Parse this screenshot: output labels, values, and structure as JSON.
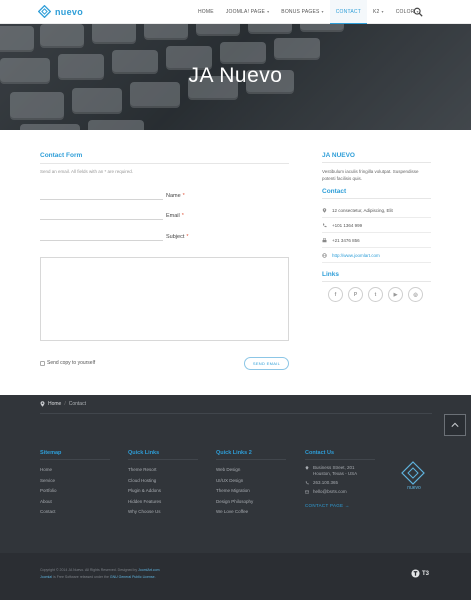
{
  "header": {
    "logo_text": "nuevo",
    "nav": [
      {
        "label": "HOME",
        "dropdown": false,
        "active": false
      },
      {
        "label": "JOOMLA! PAGE",
        "dropdown": true,
        "active": false
      },
      {
        "label": "BONUS PAGES",
        "dropdown": true,
        "active": false
      },
      {
        "label": "CONTACT",
        "dropdown": false,
        "active": true
      },
      {
        "label": "K2",
        "dropdown": true,
        "active": false
      },
      {
        "label": "COLOR",
        "dropdown": true,
        "active": false
      }
    ],
    "caret": "▾",
    "search_icon": "search-icon"
  },
  "hero": {
    "title": "JA Nuevo"
  },
  "form": {
    "title": "Contact Form",
    "note": "Send an email. All fields with an * are required.",
    "name_label": "Name",
    "email_label": "Email",
    "subject_label": "Subject",
    "required_mark": "*",
    "copy_label": "Send copy to yourself",
    "send_button": "SEND EMAIL"
  },
  "sidebar": {
    "title": "JA NUEVO",
    "description": "Vestibulum iaculis fringilla volutpat. Suspendisse potenti facilisis quis.",
    "contact_title": "Contact",
    "address": "12 consectetur, Adipiscing, Elit",
    "phone": "+101 1364 999",
    "fax": "+21 3476 856",
    "website": "http://www.joomlart.com",
    "links_title": "Links",
    "social": [
      {
        "icon": "facebook-icon",
        "glyph": "f"
      },
      {
        "icon": "pinterest-icon",
        "glyph": "P"
      },
      {
        "icon": "twitter-icon",
        "glyph": "t"
      },
      {
        "icon": "youtube-icon",
        "glyph": "▶"
      },
      {
        "icon": "instagram-icon",
        "glyph": "◎"
      }
    ]
  },
  "footer": {
    "breadcrumb": {
      "home": "Home",
      "separator": "/",
      "current": "Contact"
    },
    "back_to_top_icon": "chevron-up-icon",
    "sitemap": {
      "title": "Sitemap",
      "links": [
        "Home",
        "Service",
        "Portfolio",
        "About",
        "Contact"
      ]
    },
    "quick_links": {
      "title": "Quick Links",
      "links": [
        "Theme Resort",
        "Cloud Hosting",
        "Plugin & Addons",
        "Hidden Features",
        "Why Choose Us"
      ]
    },
    "quick_links_2": {
      "title": "Quick Links 2",
      "links": [
        "Web Design",
        "UI/UX Design",
        "Theme Migration",
        "Design Philosophy",
        "We Love Coffee"
      ]
    },
    "contact_us": {
      "title": "Contact Us",
      "address_line1": "Business Street, 201",
      "address_line2": "Houston, Texas - USA",
      "phone": "263.100.365",
      "email": "hello@bsrts.com",
      "page_link": "CONTACT PAGE"
    },
    "logo_text": "nuevo"
  },
  "bottom": {
    "copyright_text": "Copyright © 2014 JA Nuevo. All Rights Reserved. Designed by",
    "copyright_link": "JoomlArt.com",
    "license_lead": "Joomla!",
    "license_text": "is Free Software released under the",
    "license_link": "GNU General Public License.",
    "t3_text": "T3"
  },
  "colors": {
    "accent": "#2e9ed8",
    "footer_bg": "#31353a",
    "bottom_bg": "#2b2e33"
  }
}
